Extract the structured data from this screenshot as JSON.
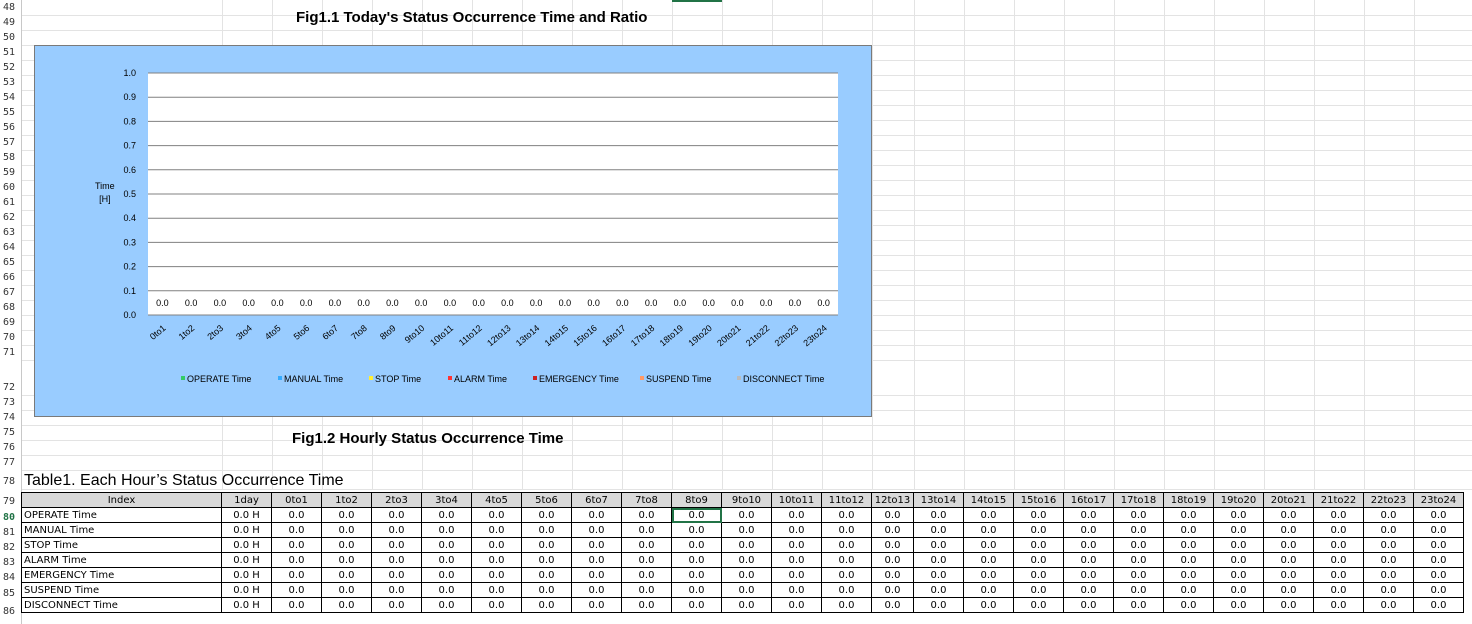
{
  "row_numbers": [
    "48",
    "49",
    "50",
    "51",
    "52",
    "53",
    "54",
    "55",
    "56",
    "57",
    "58",
    "59",
    "60",
    "61",
    "62",
    "63",
    "64",
    "65",
    "66",
    "67",
    "68",
    "69",
    "70",
    "71",
    "72",
    "73",
    "74",
    "75",
    "76",
    "77",
    "78",
    "79",
    "80",
    "81",
    "82",
    "83",
    "84",
    "85",
    "86"
  ],
  "active_row": "80",
  "fig1_title": "Fig1.1 Today's Status Occurrence Time and Ratio",
  "fig2_title": "Fig1.2 Hourly Status Occurrence Time",
  "chart_data": {
    "type": "bar",
    "title": "",
    "ylabel": "Time [H]",
    "ylabel_lines": [
      "Time",
      "[H]"
    ],
    "xlabel": "",
    "ylim": [
      0,
      1.0
    ],
    "yticks": [
      "1.0",
      "0.9",
      "0.8",
      "0.7",
      "0.6",
      "0.5",
      "0.4",
      "0.3",
      "0.2",
      "0.1",
      "0.0"
    ],
    "grid": true,
    "legend_position": "bottom",
    "categories": [
      "0to1",
      "1to2",
      "2to3",
      "3to4",
      "4to5",
      "5to6",
      "6to7",
      "7to8",
      "8to9",
      "9to10",
      "10to11",
      "11to12",
      "12to13",
      "13to14",
      "14to15",
      "15to16",
      "16to17",
      "17to18",
      "18to19",
      "19to20",
      "20to21",
      "21to22",
      "22to23",
      "23to24"
    ],
    "data_labels": [
      "0.0",
      "0.0",
      "0.0",
      "0.0",
      "0.0",
      "0.0",
      "0.0",
      "0.0",
      "0.0",
      "0.0",
      "0.0",
      "0.0",
      "0.0",
      "0.0",
      "0.0",
      "0.0",
      "0.0",
      "0.0",
      "0.0",
      "0.0",
      "0.0",
      "0.0",
      "0.0",
      "0.0"
    ],
    "series": [
      {
        "name": "OPERATE Time",
        "color": "#33cc66",
        "values": [
          0,
          0,
          0,
          0,
          0,
          0,
          0,
          0,
          0,
          0,
          0,
          0,
          0,
          0,
          0,
          0,
          0,
          0,
          0,
          0,
          0,
          0,
          0,
          0
        ]
      },
      {
        "name": "MANUAL Time",
        "color": "#33aaff",
        "values": [
          0,
          0,
          0,
          0,
          0,
          0,
          0,
          0,
          0,
          0,
          0,
          0,
          0,
          0,
          0,
          0,
          0,
          0,
          0,
          0,
          0,
          0,
          0,
          0
        ]
      },
      {
        "name": "STOP Time",
        "color": "#ffee33",
        "values": [
          0,
          0,
          0,
          0,
          0,
          0,
          0,
          0,
          0,
          0,
          0,
          0,
          0,
          0,
          0,
          0,
          0,
          0,
          0,
          0,
          0,
          0,
          0,
          0
        ]
      },
      {
        "name": "ALARM Time",
        "color": "#ff3333",
        "values": [
          0,
          0,
          0,
          0,
          0,
          0,
          0,
          0,
          0,
          0,
          0,
          0,
          0,
          0,
          0,
          0,
          0,
          0,
          0,
          0,
          0,
          0,
          0,
          0
        ]
      },
      {
        "name": "EMERGENCY Time",
        "color": "#cc2222",
        "values": [
          0,
          0,
          0,
          0,
          0,
          0,
          0,
          0,
          0,
          0,
          0,
          0,
          0,
          0,
          0,
          0,
          0,
          0,
          0,
          0,
          0,
          0,
          0,
          0
        ]
      },
      {
        "name": "SUSPEND Time",
        "color": "#ff9966",
        "values": [
          0,
          0,
          0,
          0,
          0,
          0,
          0,
          0,
          0,
          0,
          0,
          0,
          0,
          0,
          0,
          0,
          0,
          0,
          0,
          0,
          0,
          0,
          0,
          0
        ]
      },
      {
        "name": "DISCONNECT Time",
        "color": "#bbbbbb",
        "values": [
          0,
          0,
          0,
          0,
          0,
          0,
          0,
          0,
          0,
          0,
          0,
          0,
          0,
          0,
          0,
          0,
          0,
          0,
          0,
          0,
          0,
          0,
          0,
          0
        ]
      }
    ]
  },
  "table": {
    "title": "Table1. Each Hour’s Status Occurrence Time",
    "headers": [
      "Index",
      "1day",
      "0to1",
      "1to2",
      "2to3",
      "3to4",
      "4to5",
      "5to6",
      "6to7",
      "7to8",
      "8to9",
      "9to10",
      "10to11",
      "11to12",
      "12to13",
      "13to14",
      "14to15",
      "15to16",
      "16to17",
      "17to18",
      "18to19",
      "19to20",
      "20to21",
      "21to22",
      "22to23",
      "23to24"
    ],
    "rows": [
      {
        "label": "OPERATE Time",
        "day": "0.0 H",
        "hours": [
          "0.0",
          "0.0",
          "0.0",
          "0.0",
          "0.0",
          "0.0",
          "0.0",
          "0.0",
          "0.0",
          "0.0",
          "0.0",
          "0.0",
          "0.0",
          "0.0",
          "0.0",
          "0.0",
          "0.0",
          "0.0",
          "0.0",
          "0.0",
          "0.0",
          "0.0",
          "0.0",
          "0.0"
        ]
      },
      {
        "label": "MANUAL Time",
        "day": "0.0 H",
        "hours": [
          "0.0",
          "0.0",
          "0.0",
          "0.0",
          "0.0",
          "0.0",
          "0.0",
          "0.0",
          "0.0",
          "0.0",
          "0.0",
          "0.0",
          "0.0",
          "0.0",
          "0.0",
          "0.0",
          "0.0",
          "0.0",
          "0.0",
          "0.0",
          "0.0",
          "0.0",
          "0.0",
          "0.0"
        ]
      },
      {
        "label": "STOP Time",
        "day": "0.0 H",
        "hours": [
          "0.0",
          "0.0",
          "0.0",
          "0.0",
          "0.0",
          "0.0",
          "0.0",
          "0.0",
          "0.0",
          "0.0",
          "0.0",
          "0.0",
          "0.0",
          "0.0",
          "0.0",
          "0.0",
          "0.0",
          "0.0",
          "0.0",
          "0.0",
          "0.0",
          "0.0",
          "0.0",
          "0.0"
        ]
      },
      {
        "label": "ALARM Time",
        "day": "0.0 H",
        "hours": [
          "0.0",
          "0.0",
          "0.0",
          "0.0",
          "0.0",
          "0.0",
          "0.0",
          "0.0",
          "0.0",
          "0.0",
          "0.0",
          "0.0",
          "0.0",
          "0.0",
          "0.0",
          "0.0",
          "0.0",
          "0.0",
          "0.0",
          "0.0",
          "0.0",
          "0.0",
          "0.0",
          "0.0"
        ]
      },
      {
        "label": "EMERGENCY Time",
        "day": "0.0 H",
        "hours": [
          "0.0",
          "0.0",
          "0.0",
          "0.0",
          "0.0",
          "0.0",
          "0.0",
          "0.0",
          "0.0",
          "0.0",
          "0.0",
          "0.0",
          "0.0",
          "0.0",
          "0.0",
          "0.0",
          "0.0",
          "0.0",
          "0.0",
          "0.0",
          "0.0",
          "0.0",
          "0.0",
          "0.0"
        ]
      },
      {
        "label": "SUSPEND Time",
        "day": "0.0 H",
        "hours": [
          "0.0",
          "0.0",
          "0.0",
          "0.0",
          "0.0",
          "0.0",
          "0.0",
          "0.0",
          "0.0",
          "0.0",
          "0.0",
          "0.0",
          "0.0",
          "0.0",
          "0.0",
          "0.0",
          "0.0",
          "0.0",
          "0.0",
          "0.0",
          "0.0",
          "0.0",
          "0.0",
          "0.0"
        ]
      },
      {
        "label": "DISCONNECT Time",
        "day": "0.0 H",
        "hours": [
          "0.0",
          "0.0",
          "0.0",
          "0.0",
          "0.0",
          "0.0",
          "0.0",
          "0.0",
          "0.0",
          "0.0",
          "0.0",
          "0.0",
          "0.0",
          "0.0",
          "0.0",
          "0.0",
          "0.0",
          "0.0",
          "0.0",
          "0.0",
          "0.0",
          "0.0",
          "0.0",
          "0.0"
        ]
      }
    ],
    "selected_cell": {
      "row": 0,
      "col": "8to9"
    }
  }
}
